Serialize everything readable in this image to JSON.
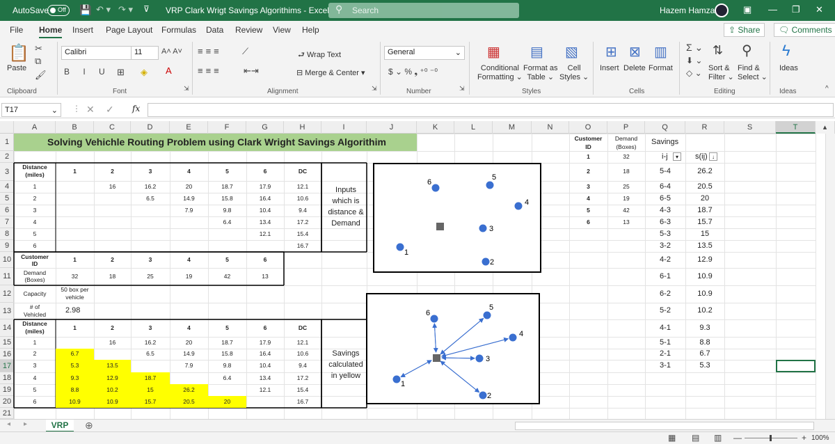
{
  "titlebar": {
    "autosave": "AutoSave",
    "toggle": "Off",
    "title": "VRP Clark Wrigt Savings Algorithims  -  Excel",
    "search": "Search",
    "user": "Hazem Hamza"
  },
  "menu": [
    "File",
    "Home",
    "Insert",
    "Page Layout",
    "Formulas",
    "Data",
    "Review",
    "View",
    "Help"
  ],
  "share": "Share",
  "comments": "Comments",
  "ribbon": {
    "paste": "Paste",
    "font_name": "Calibri",
    "font_size": "11",
    "wrap_text": "Wrap Text",
    "merge_center": "Merge & Center",
    "number_format": "General",
    "conditional": "Conditional",
    "formatting": "Formatting",
    "format_as": "Format as",
    "table": "Table",
    "cell": "Cell",
    "styles_lbl": "Styles",
    "insert": "Insert",
    "delete": "Delete",
    "format": "Format",
    "sort_filter": "Sort &",
    "filter": "Filter",
    "find": "Find &",
    "select": "Select",
    "ideas": "Ideas",
    "groups": {
      "clipboard": "Clipboard",
      "font": "Font",
      "alignment": "Alignment",
      "number": "Number",
      "styles": "Styles",
      "cells": "Cells",
      "editing": "Editing",
      "ideas": "Ideas"
    }
  },
  "namebox": "T17",
  "columns": [
    "A",
    "B",
    "C",
    "D",
    "E",
    "F",
    "G",
    "H",
    "I",
    "J",
    "K",
    "L",
    "M",
    "N",
    "O",
    "P",
    "Q",
    "R",
    "S",
    "T"
  ],
  "selected_col": "T",
  "selected_row": "17",
  "rows": [
    "1",
    "2",
    "3",
    "4",
    "5",
    "6",
    "7",
    "8",
    "9",
    "10",
    "11",
    "12",
    "13",
    "14",
    "15",
    "16",
    "17",
    "18",
    "19",
    "20",
    "21"
  ],
  "sheet": {
    "title": "Solving Vehichle Routing Problem using Clark Wright Savings Algorithim",
    "dist_label1": "Distance",
    "dist_label2": "(miles)",
    "headers": [
      "1",
      "2",
      "3",
      "4",
      "5",
      "6",
      "DC"
    ],
    "dist_rows": [
      {
        "r": "1",
        "v": [
          "",
          "16",
          "16.2",
          "20",
          "18.7",
          "17.9",
          "12.1"
        ]
      },
      {
        "r": "2",
        "v": [
          "",
          "",
          "6.5",
          "14.9",
          "15.8",
          "16.4",
          "10.6"
        ]
      },
      {
        "r": "3",
        "v": [
          "",
          "",
          "",
          "7.9",
          "9.8",
          "10.4",
          "9.4"
        ]
      },
      {
        "r": "4",
        "v": [
          "",
          "",
          "",
          "",
          "6.4",
          "13.4",
          "17.2"
        ]
      },
      {
        "r": "5",
        "v": [
          "",
          "",
          "",
          "",
          "",
          "12.1",
          "15.4"
        ]
      },
      {
        "r": "6",
        "v": [
          "",
          "",
          "",
          "",
          "",
          "",
          "16.7"
        ]
      }
    ],
    "cust_label1": "Customer",
    "cust_label2": "ID",
    "cust_ids": [
      "1",
      "2",
      "3",
      "4",
      "5",
      "6"
    ],
    "demand_label1": "Demand",
    "demand_label2": "(Boxes)",
    "demands": [
      "32",
      "18",
      "25",
      "19",
      "42",
      "13"
    ],
    "capacity_label": "Capacity",
    "capacity_value1": "50 box per",
    "capacity_value2": "vehicle",
    "vehicles_label1": "# of",
    "vehicles_label2": "Vehicled",
    "vehicles_value": "2.98",
    "save_rows": [
      {
        "r": "1",
        "v": [
          "",
          "16",
          "16.2",
          "20",
          "18.7",
          "17.9",
          "12.1"
        ]
      },
      {
        "r": "2",
        "v": [
          "6.7",
          "",
          "6.5",
          "14.9",
          "15.8",
          "16.4",
          "10.6"
        ]
      },
      {
        "r": "3",
        "v": [
          "5.3",
          "13.5",
          "",
          "7.9",
          "9.8",
          "10.4",
          "9.4"
        ]
      },
      {
        "r": "4",
        "v": [
          "9.3",
          "12.9",
          "18.7",
          "",
          "6.4",
          "13.4",
          "17.2"
        ]
      },
      {
        "r": "5",
        "v": [
          "8.8",
          "10.2",
          "15",
          "26.2",
          "",
          "12.1",
          "15.4"
        ]
      },
      {
        "r": "6",
        "v": [
          "10.9",
          "10.9",
          "15.7",
          "20.5",
          "20",
          "",
          "16.7"
        ]
      }
    ],
    "inputs_note": [
      "Inputs",
      "which is",
      "distance &",
      "Demand"
    ],
    "savings_note": [
      "Savings",
      "calculated",
      "in yellow"
    ],
    "cust_table_hdr": [
      "Customer",
      "ID",
      "Demand",
      "(Boxes)"
    ],
    "cust_table": [
      [
        "1",
        "32"
      ],
      [
        "2",
        "18"
      ],
      [
        "3",
        "25"
      ],
      [
        "4",
        "19"
      ],
      [
        "5",
        "42"
      ],
      [
        "6",
        "13"
      ]
    ],
    "savings_title": "Savings",
    "savings_hdr": [
      "i-j",
      "s(ij)"
    ],
    "savings": [
      [
        "5-4",
        "26.2"
      ],
      [
        "6-4",
        "20.5"
      ],
      [
        "6-5",
        "20"
      ],
      [
        "4-3",
        "18.7"
      ],
      [
        "6-3",
        "15.7"
      ],
      [
        "5-3",
        "15"
      ],
      [
        "3-2",
        "13.5"
      ],
      [
        "4-2",
        "12.9"
      ],
      [
        "6-1",
        "10.9"
      ],
      [
        "6-2",
        "10.9"
      ],
      [
        "5-2",
        "10.2"
      ],
      [
        "4-1",
        "9.3"
      ],
      [
        "5-1",
        "8.8"
      ],
      [
        "2-1",
        "6.7"
      ],
      [
        "3-1",
        "5.3"
      ]
    ],
    "map_labels": [
      "1",
      "2",
      "3",
      "4",
      "5",
      "6"
    ]
  },
  "sheet_tab": "VRP",
  "zoom": "100%",
  "colors": {
    "excel_green": "#217346",
    "title_fill": "#a9d18e",
    "yellow": "#ffff00",
    "node": "#3a6fd0"
  }
}
